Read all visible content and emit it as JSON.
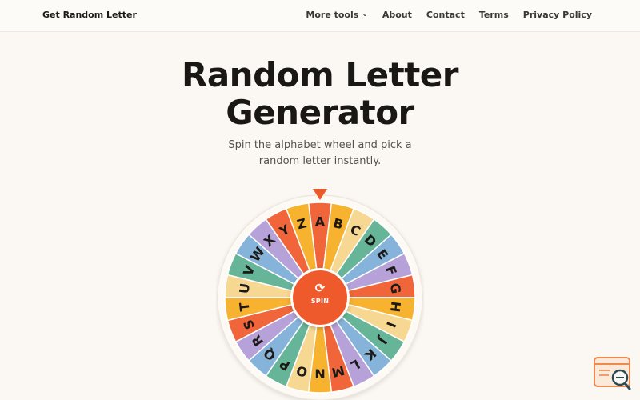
{
  "brand": "Get Random Letter",
  "nav": {
    "more_tools": "More tools",
    "about": "About",
    "contact": "Contact",
    "terms": "Terms",
    "privacy": "Privacy Policy"
  },
  "hero": {
    "title_line1": "Random Letter",
    "title_line2": "Generator",
    "subtitle_line1": "Spin the alphabet wheel and pick a",
    "subtitle_line2": "random letter instantly."
  },
  "wheel": {
    "letters": [
      "A",
      "B",
      "C",
      "D",
      "E",
      "F",
      "G",
      "H",
      "I",
      "J",
      "K",
      "L",
      "M",
      "N",
      "O",
      "P",
      "Q",
      "R",
      "S",
      "T",
      "U",
      "V",
      "W",
      "X",
      "Y",
      "Z"
    ],
    "segment_colors": [
      "#f0663a",
      "#f7b22f",
      "#f6d892",
      "#66b598",
      "#86b3da",
      "#b6a1d8"
    ],
    "spin_label": "SPIN",
    "spin_icon": "refresh-icon",
    "pointer_color": "#ee5a2b"
  },
  "colors": {
    "accent": "#ee5a2b",
    "background": "#fbf8f3"
  },
  "helper_icon": "search-document-icon"
}
